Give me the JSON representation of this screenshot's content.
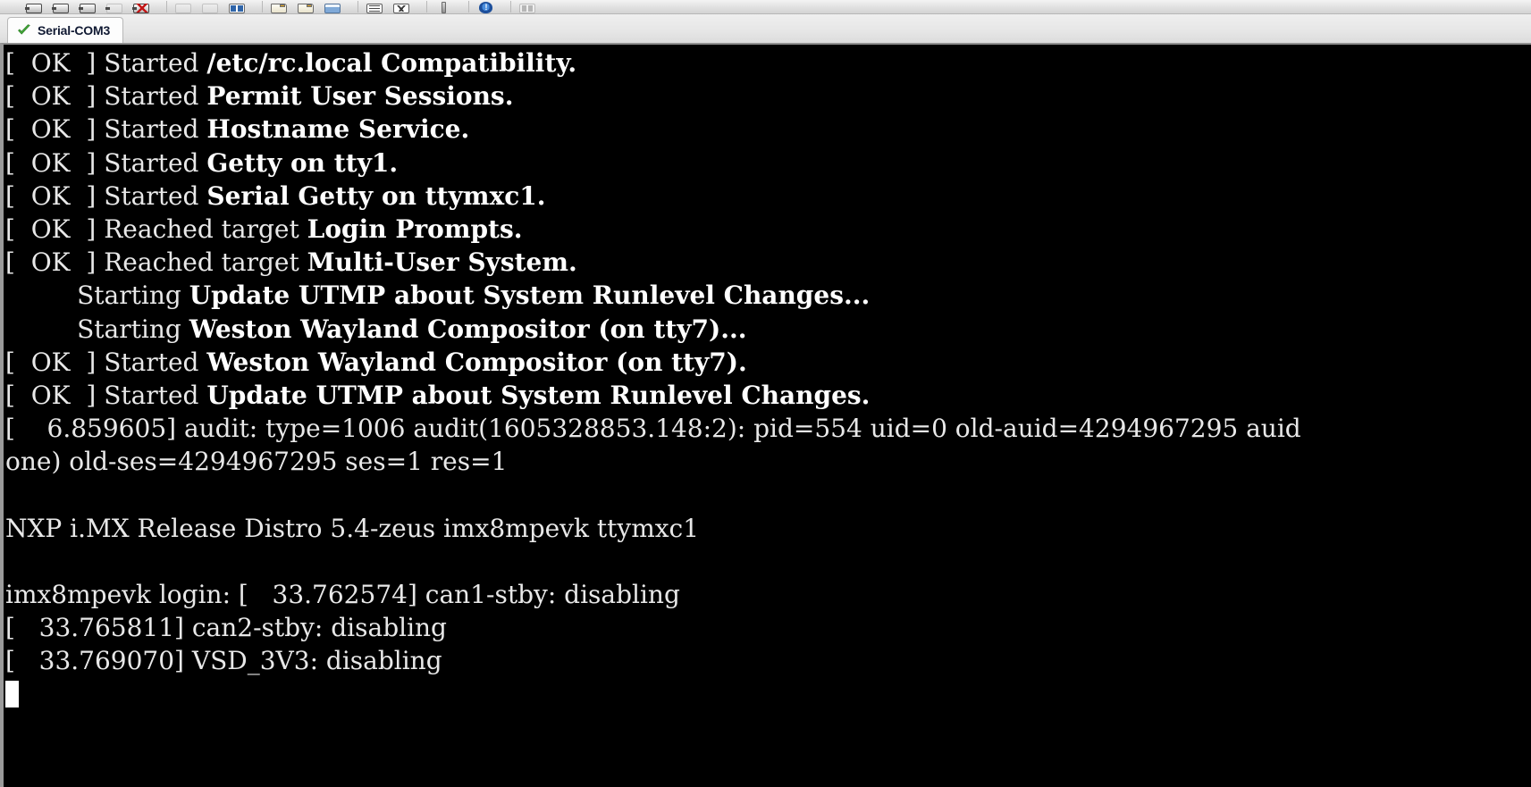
{
  "window": {
    "toolbar": {
      "icons": [
        {
          "name": "connect-icon",
          "kind": "plug"
        },
        {
          "name": "reconnect-icon",
          "kind": "plug"
        },
        {
          "name": "disconnect-icon",
          "kind": "plug"
        },
        {
          "name": "disconnect-all-icon",
          "kind": "plug disabled"
        },
        {
          "name": "stop-connection-icon",
          "kind": "plug redx"
        },
        {
          "name": "copy-icon",
          "kind": "disabled"
        },
        {
          "name": "paste-icon",
          "kind": "disabled"
        },
        {
          "name": "split-view-icon",
          "kind": "bluepanes"
        },
        {
          "name": "open-log-icon",
          "kind": "folder"
        },
        {
          "name": "save-log-icon",
          "kind": "folder"
        },
        {
          "name": "window-icon",
          "kind": "window"
        },
        {
          "name": "log-list-icon",
          "kind": "lines"
        },
        {
          "name": "xmodem-icon",
          "kind": "abc"
        },
        {
          "name": "marker-icon",
          "kind": "pencil"
        },
        {
          "name": "about-icon",
          "kind": "shield"
        },
        {
          "name": "layout-icon",
          "kind": "grid disabled"
        }
      ]
    },
    "tab": {
      "label": "Serial-COM3",
      "status_icon": "green-check-icon",
      "check_color": "#3fa535"
    }
  },
  "terminal": {
    "background": "#000000",
    "foreground": "#e8e8e8",
    "bold_foreground": "#ffffff",
    "cursor": "block-cursor",
    "lines": [
      {
        "id": "line-01",
        "segments": [
          {
            "text": "[  OK  ] Started ",
            "style": "plain"
          },
          {
            "text": "/etc/rc.local Compatibility.",
            "style": "bold"
          }
        ]
      },
      {
        "id": "line-02",
        "segments": [
          {
            "text": "[  OK  ] Started ",
            "style": "plain"
          },
          {
            "text": "Permit User Sessions.",
            "style": "bold"
          }
        ]
      },
      {
        "id": "line-03",
        "segments": [
          {
            "text": "[  OK  ] Started ",
            "style": "plain"
          },
          {
            "text": "Hostname Service.",
            "style": "bold"
          }
        ]
      },
      {
        "id": "line-04",
        "segments": [
          {
            "text": "[  OK  ] Started ",
            "style": "plain"
          },
          {
            "text": "Getty on tty1.",
            "style": "bold"
          }
        ]
      },
      {
        "id": "line-05",
        "segments": [
          {
            "text": "[  OK  ] Started ",
            "style": "plain"
          },
          {
            "text": "Serial Getty on ttymxc1.",
            "style": "bold"
          }
        ]
      },
      {
        "id": "line-06",
        "segments": [
          {
            "text": "[  OK  ] Reached target ",
            "style": "plain"
          },
          {
            "text": "Login Prompts.",
            "style": "bold"
          }
        ]
      },
      {
        "id": "line-07",
        "segments": [
          {
            "text": "[  OK  ] Reached target ",
            "style": "plain"
          },
          {
            "text": "Multi-User System.",
            "style": "bold"
          }
        ]
      },
      {
        "id": "line-08",
        "segments": [
          {
            "text": "         Starting ",
            "style": "plain"
          },
          {
            "text": "Update UTMP about System Runlevel Changes...",
            "style": "bold"
          }
        ]
      },
      {
        "id": "line-09",
        "segments": [
          {
            "text": "         Starting ",
            "style": "plain"
          },
          {
            "text": "Weston Wayland Compositor (on tty7)...",
            "style": "bold"
          }
        ]
      },
      {
        "id": "line-10",
        "segments": [
          {
            "text": "[  OK  ] Started ",
            "style": "plain"
          },
          {
            "text": "Weston Wayland Compositor (on tty7).",
            "style": "bold"
          }
        ]
      },
      {
        "id": "line-11",
        "segments": [
          {
            "text": "[  OK  ] Started ",
            "style": "plain"
          },
          {
            "text": "Update UTMP about System Runlevel Changes.",
            "style": "bold"
          }
        ]
      },
      {
        "id": "line-12",
        "segments": [
          {
            "text": "[    6.859605] audit: type=1006 audit(1605328853.148:2): pid=554 uid=0 old-auid=4294967295 auid",
            "style": "plain"
          }
        ]
      },
      {
        "id": "line-13",
        "segments": [
          {
            "text": "one) old-ses=4294967295 ses=1 res=1",
            "style": "plain"
          }
        ]
      },
      {
        "id": "line-14",
        "segments": [
          {
            "text": " ",
            "style": "plain"
          }
        ]
      },
      {
        "id": "line-15",
        "segments": [
          {
            "text": "NXP i.MX Release Distro 5.4-zeus imx8mpevk ttymxc1",
            "style": "plain"
          }
        ]
      },
      {
        "id": "line-16",
        "segments": [
          {
            "text": " ",
            "style": "plain"
          }
        ]
      },
      {
        "id": "line-17",
        "segments": [
          {
            "text": "imx8mpevk login: [   33.762574] can1-stby: disabling",
            "style": "plain"
          }
        ]
      },
      {
        "id": "line-18",
        "segments": [
          {
            "text": "[   33.765811] can2-stby: disabling",
            "style": "plain"
          }
        ]
      },
      {
        "id": "line-19",
        "segments": [
          {
            "text": "[   33.769070] VSD_3V3: disabling",
            "style": "plain"
          }
        ]
      }
    ]
  }
}
